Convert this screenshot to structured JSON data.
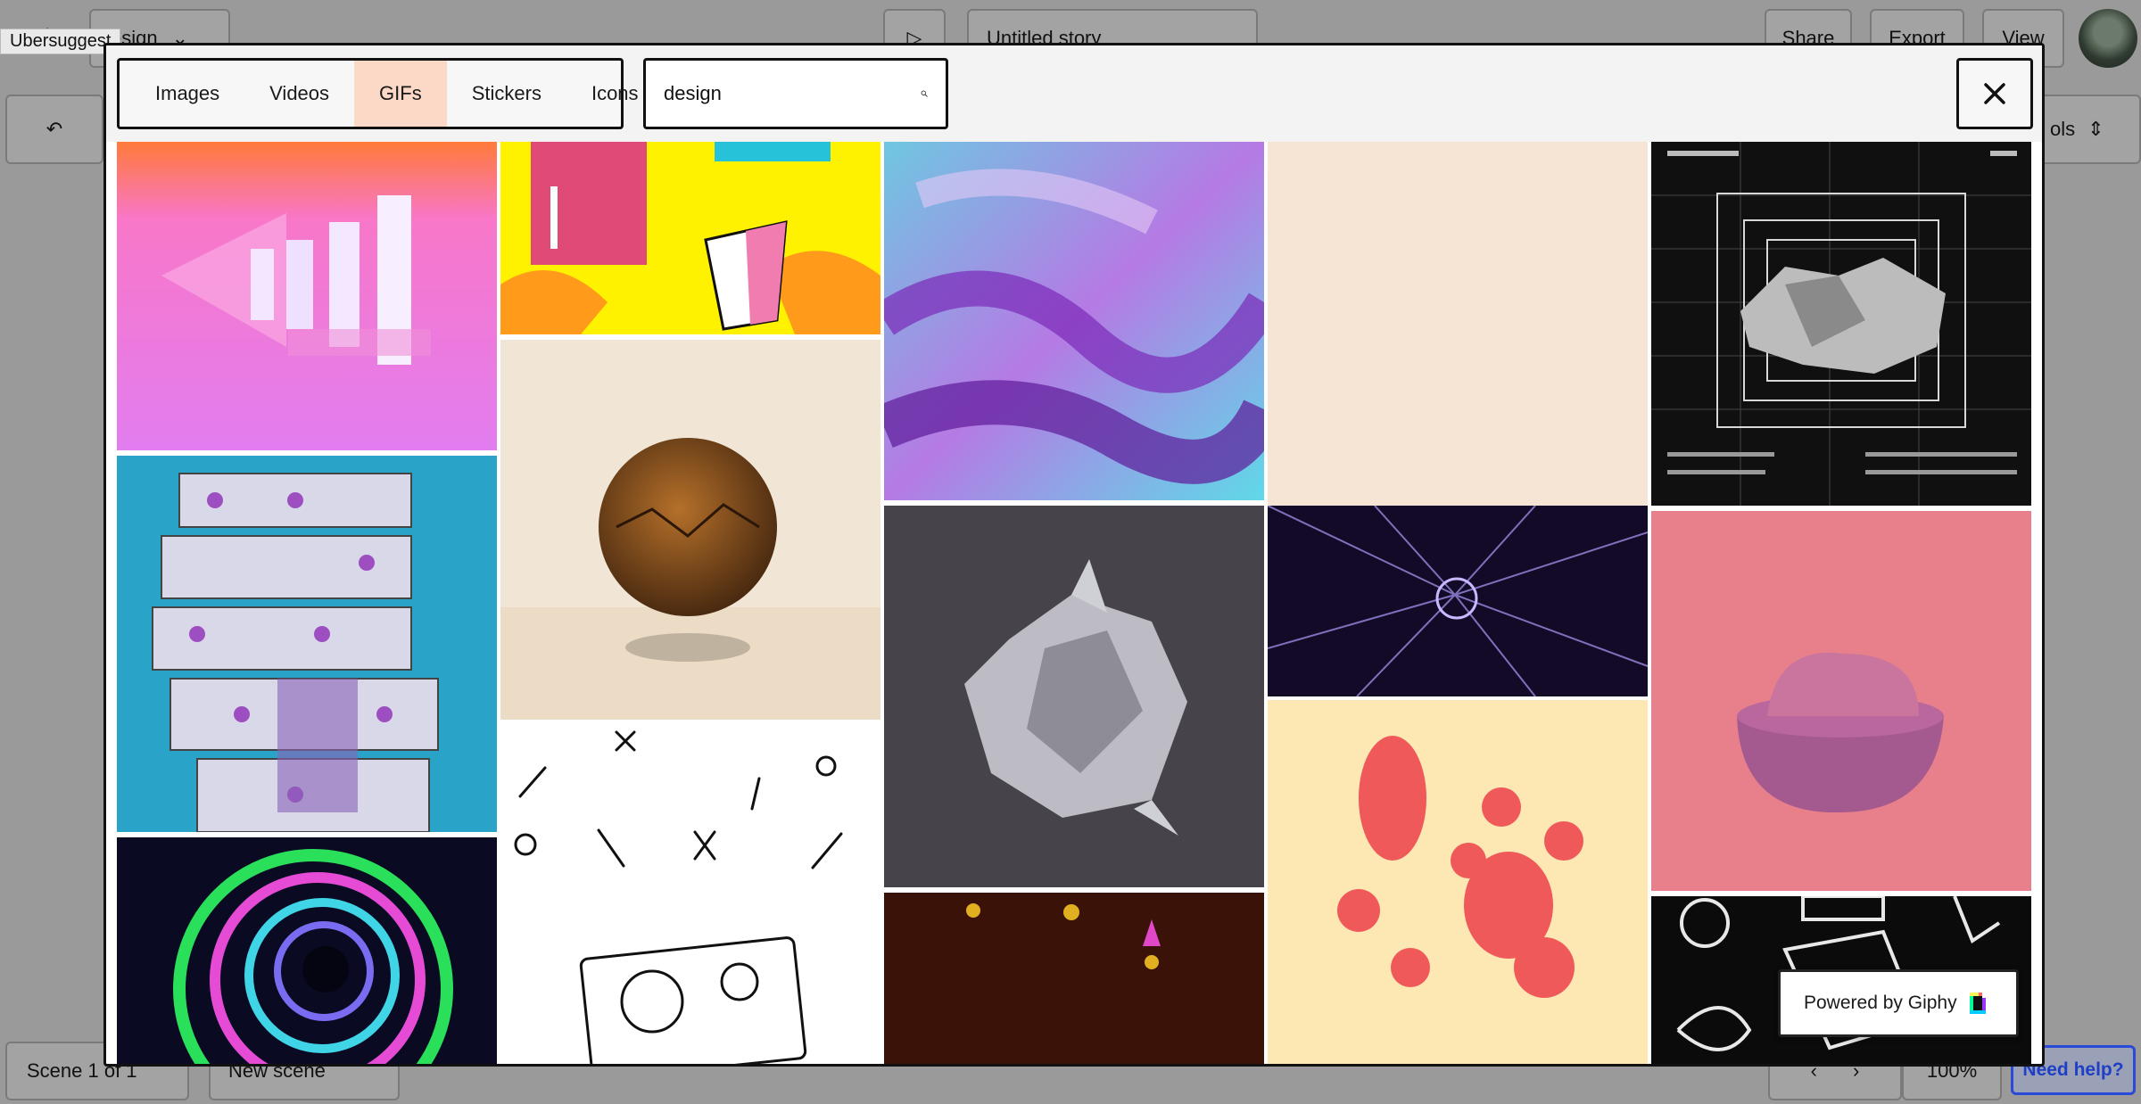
{
  "background": {
    "scene_title": "esign",
    "story_title": "Untitled story",
    "share_label": "Share",
    "export_label": "Export",
    "view_label": "View",
    "tools_label": "ols",
    "scene_selector": "Scene 1 of 1",
    "new_scene_label": "New scene",
    "zoom": "100%",
    "help_label": "Need help?",
    "extension_badge": "Ubersuggest"
  },
  "modal": {
    "tabs": [
      {
        "label": "Images",
        "active": false
      },
      {
        "label": "Videos",
        "active": false
      },
      {
        "label": "GIFs",
        "active": true
      },
      {
        "label": "Stickers",
        "active": false
      },
      {
        "label": "Icons",
        "active": false
      }
    ],
    "search": {
      "value": "design"
    },
    "close_icon": "close-icon",
    "search_icon": "search-icon",
    "powered_by": "Powered by Giphy",
    "active_tab_color": "#fcd9c6"
  }
}
